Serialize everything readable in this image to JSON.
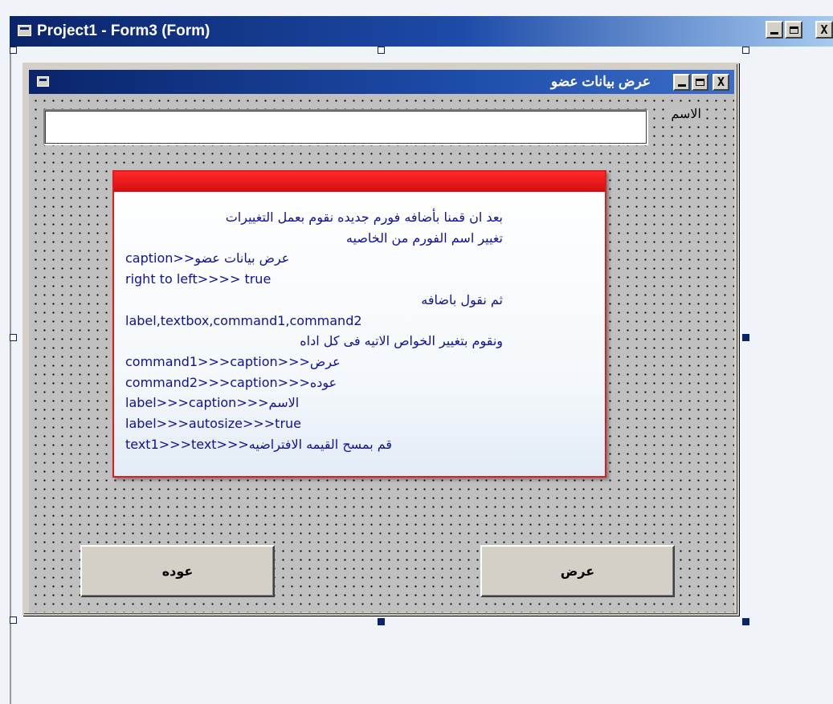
{
  "outer_window": {
    "title": "Project1 - Form3 (Form)",
    "controls": {
      "minimize": "_",
      "maximize": "□",
      "close": "X"
    }
  },
  "form": {
    "title": "عرض بيانات عضو",
    "controls": {
      "minimize": "_",
      "maximize": "□",
      "close": "X"
    },
    "name_label": "الاسم",
    "name_value": "",
    "button_back": "عوده",
    "button_show": "عرض"
  },
  "note": {
    "lines": [
      "بعد ان قمنا بأضافه فورم جديده نقوم بعمل التغييرات",
      "تغيير اسم الفورم من الخاصيه",
      "عرض بيانات عضو<<caption",
      "right to left>>>> true",
      "ثم نقول باضافه",
      "label,textbox,command1,command2",
      "ونقوم بتغيير الخواص الاتيه فى كل اداه",
      "command1>>>caption>>>عرض",
      "command2>>>caption>>>عوده",
      "label>>>caption>>>الاسم",
      "label>>>autosize>>>true",
      "text1>>>text>>>قم بمسح  القيمه الافتراضيه"
    ]
  },
  "colors": {
    "titlebar_start": "#0a246a",
    "titlebar_end": "#a6caf0",
    "form_background": "#c0c0c0",
    "note_border": "#e01b1b",
    "note_text": "#10109a"
  },
  "icons": [
    "form-icon",
    "minimize-icon",
    "maximize-icon",
    "close-icon"
  ]
}
